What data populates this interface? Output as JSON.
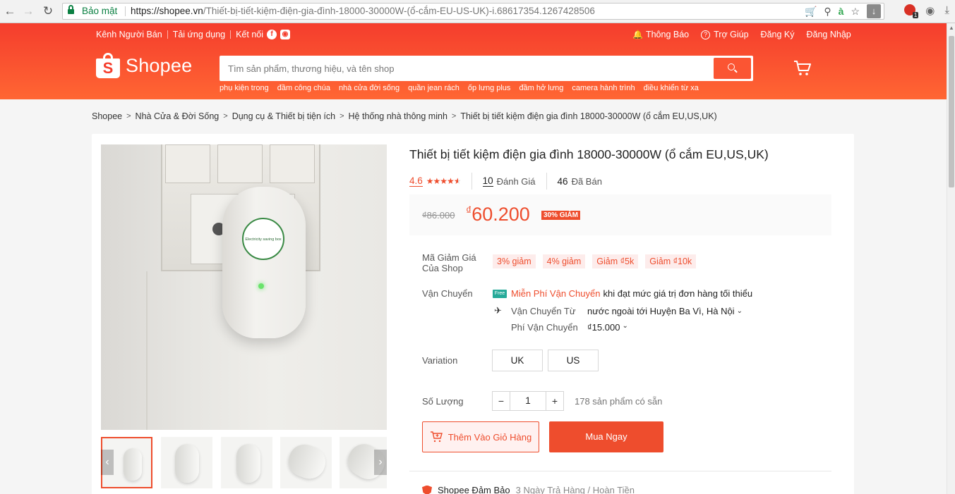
{
  "browser": {
    "secure_label": "Bảo mật",
    "url_host": "https://shopee.vn",
    "url_path": "/Thiết-bị-tiết-kiệm-điện-gia-đình-18000-30000W-(ổ-cắm-EU-US-UK)-i.68617354.1267428506"
  },
  "header": {
    "seller_channel": "Kênh Người Bán",
    "download_app": "Tải ứng dụng",
    "connect": "Kết nối",
    "notifications": "Thông Báo",
    "help": "Trợ Giúp",
    "register": "Đăng Ký",
    "login": "Đăng Nhập",
    "logo_text": "Shopee",
    "search_placeholder": "Tìm sản phẩm, thương hiệu, và tên shop",
    "keywords": [
      "phụ kiện trong",
      "đầm công chúa",
      "nhà cửa đời sống",
      "quần jean rách",
      "ốp lưng plus",
      "đầm hở lưng",
      "camera hành trình",
      "điều khiển từ xa"
    ]
  },
  "breadcrumb": [
    "Shopee",
    "Nhà Cửa & Đời Sống",
    "Dụng cụ & Thiết bị tiện ích",
    "Hệ thống nhà thông minh",
    "Thiết bị tiết kiệm điện gia đình 18000-30000W (ổ cắm EU,US,UK)"
  ],
  "product": {
    "title": "Thiết bị tiết kiệm điện gia đình 18000-30000W (ổ cắm EU,US,UK)",
    "rating": "4.6",
    "rating_fraction": 0.92,
    "reviews_count": "10",
    "reviews_label": "Đánh Giá",
    "sold_count": "46",
    "sold_label": "Đã Bán",
    "old_price": "₫86.000",
    "currency": "₫",
    "price": "60.200",
    "discount": "30% GIẢM",
    "voucher_label": "Mã Giảm Giá Của Shop",
    "vouchers": [
      "3% giảm",
      "4% giảm",
      "Giảm ₫5k",
      "Giảm ₫10k"
    ],
    "shipping_label": "Vận Chuyển",
    "free_ship_icon": "Free",
    "free_ship_link": "Miễn Phí Vận Chuyển",
    "free_ship_note": "khi đạt mức giá trị đơn hàng tối thiểu",
    "ship_from_label": "Vận Chuyển Từ",
    "ship_from_value": "nước ngoài tới Huyện Ba Vì, Hà Nội",
    "ship_fee_label": "Phí Vận Chuyển",
    "ship_fee_value": "₫15.000",
    "variation_label": "Variation",
    "variations": [
      "UK",
      "US"
    ],
    "quantity_label": "Số Lượng",
    "quantity": "1",
    "stock": "178 sản phẩm có sẵn",
    "add_to_cart": "Thêm Vào Giỏ Hàng",
    "buy_now": "Mua Ngay",
    "guarantee": "Shopee Đảm Bảo",
    "guarantee_note": "3 Ngày Trả Hàng / Hoàn Tiền",
    "device_text": "Electricity saving box"
  },
  "colors": {
    "brand": "#ee4d2d",
    "header_gradient_start": "#f53d2d",
    "header_gradient_end": "#ff6633"
  }
}
